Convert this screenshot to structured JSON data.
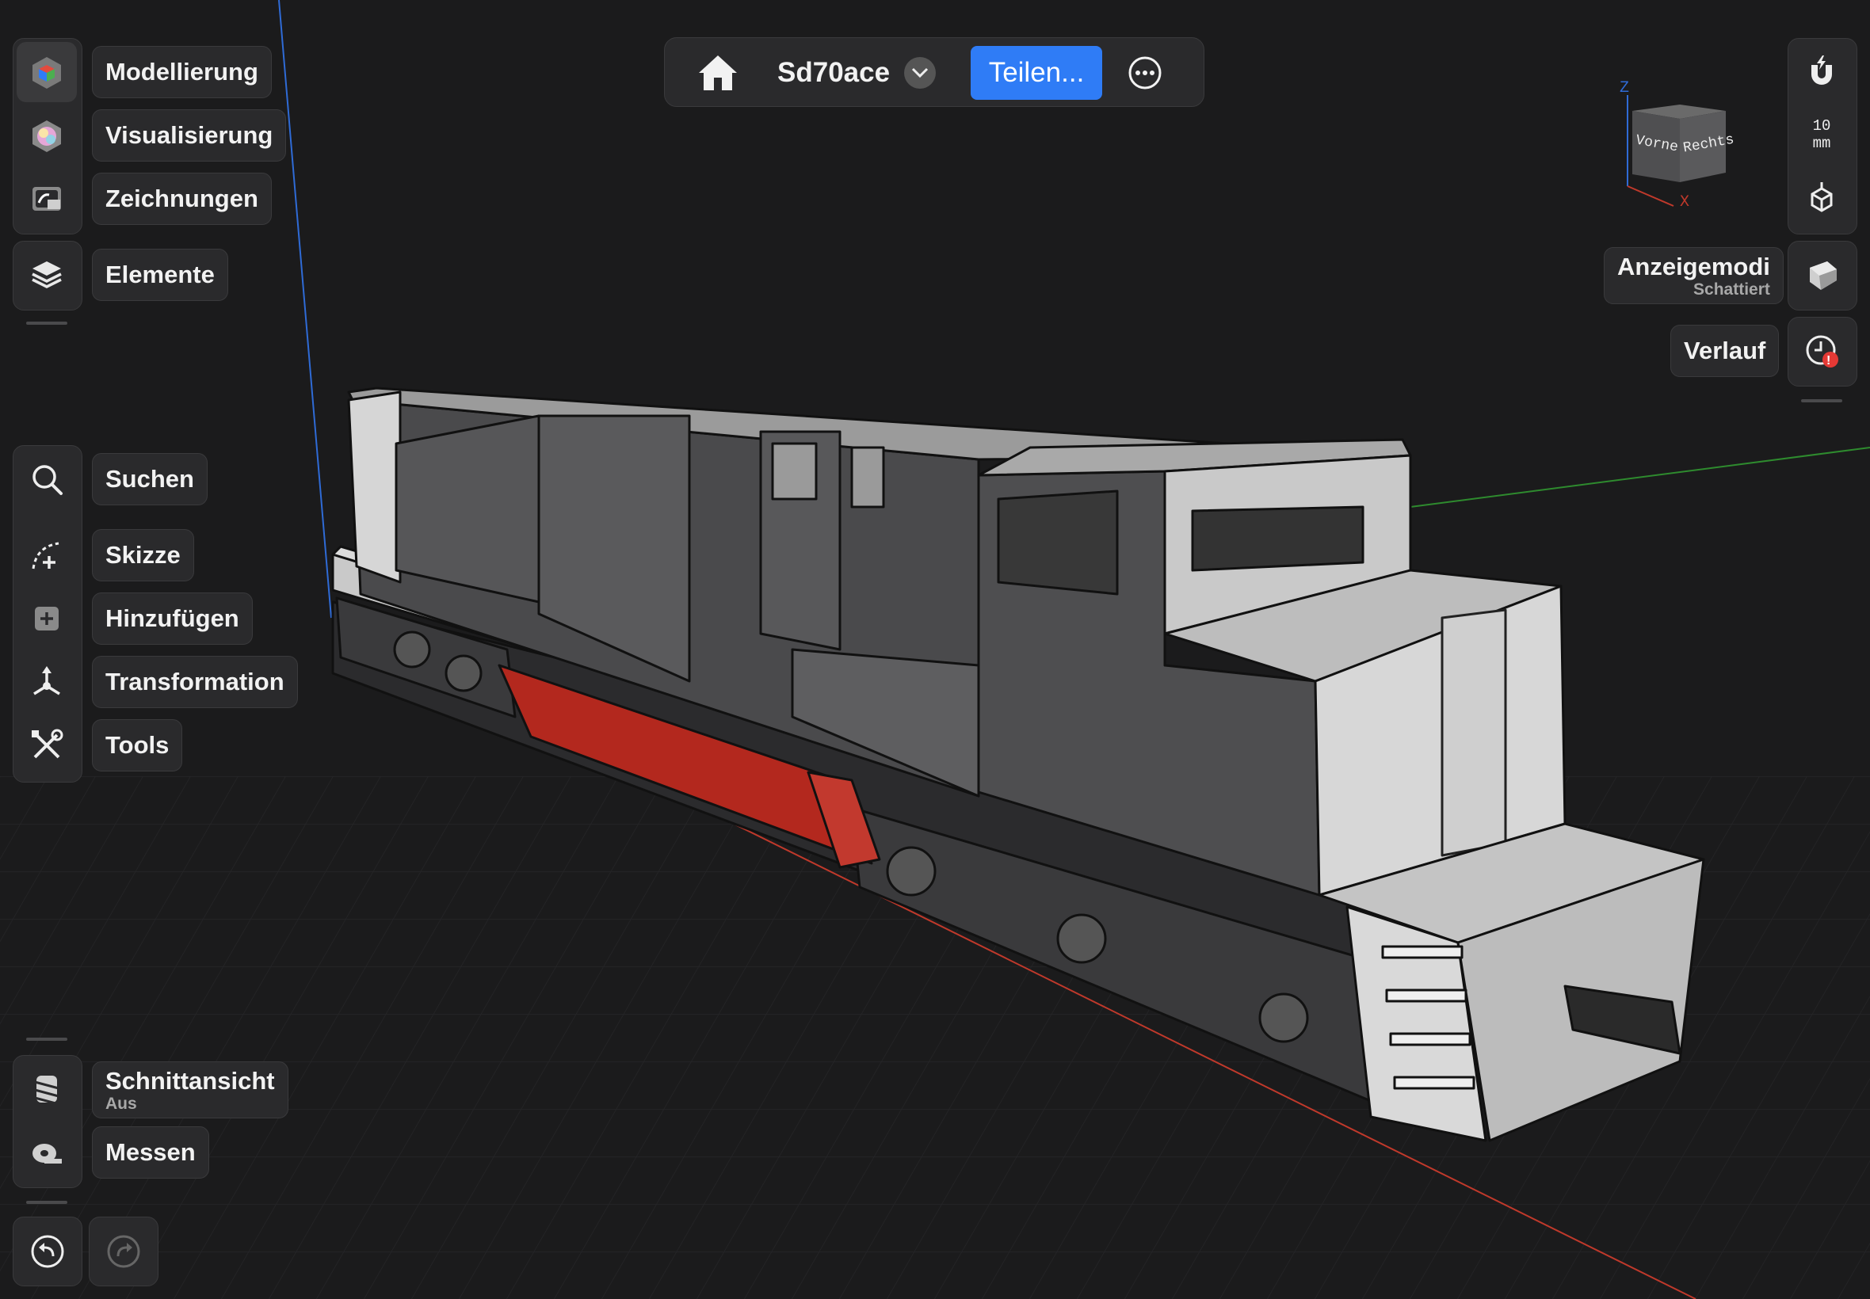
{
  "document": {
    "name": "Sd70ace",
    "share_label": "Teilen..."
  },
  "left_toolbar": {
    "workspaces": [
      {
        "label": "Modellierung",
        "icon": "modeling-cube-icon"
      },
      {
        "label": "Visualisierung",
        "icon": "visualization-sphere-icon"
      },
      {
        "label": "Zeichnungen",
        "icon": "drawings-icon"
      }
    ],
    "elements": {
      "label": "Elemente",
      "icon": "layers-icon"
    },
    "tools": [
      {
        "label": "Suchen",
        "icon": "search-icon"
      },
      {
        "label": "Skizze",
        "icon": "sketch-icon"
      },
      {
        "label": "Hinzufügen",
        "icon": "add-icon"
      },
      {
        "label": "Transformation",
        "icon": "transform-icon"
      },
      {
        "label": "Tools",
        "icon": "tools-icon"
      }
    ],
    "section_view": {
      "label": "Schnittansicht",
      "status": "Aus",
      "icon": "section-view-icon"
    },
    "measure": {
      "label": "Messen",
      "icon": "measure-tape-icon"
    }
  },
  "right_toolbar": {
    "snap_icon": "magnet-icon",
    "grid_value": "10",
    "grid_unit": "mm",
    "view_cube": {
      "front": "Vorne",
      "right": "Rechts",
      "z_axis": "Z",
      "x_axis": "X"
    },
    "display_modes": {
      "label": "Anzeigemodi",
      "status": "Schattiert",
      "icon": "shaded-display-icon"
    },
    "history": {
      "label": "Verlauf",
      "icon": "history-clock-icon",
      "alert": "!"
    }
  },
  "bottom_controls": {
    "undo_icon": "undo-icon",
    "redo_icon": "redo-icon"
  },
  "colors": {
    "background": "#1b1b1c",
    "panel": "#2a2a2c",
    "accent": "#2f7cf6",
    "selection": "#c0392b",
    "model_light": "#cfcfcf",
    "model_dark": "#4a4a4c",
    "axis_x": "#c0392b",
    "axis_y": "#2e8b2e",
    "axis_z": "#2f6bd6"
  }
}
